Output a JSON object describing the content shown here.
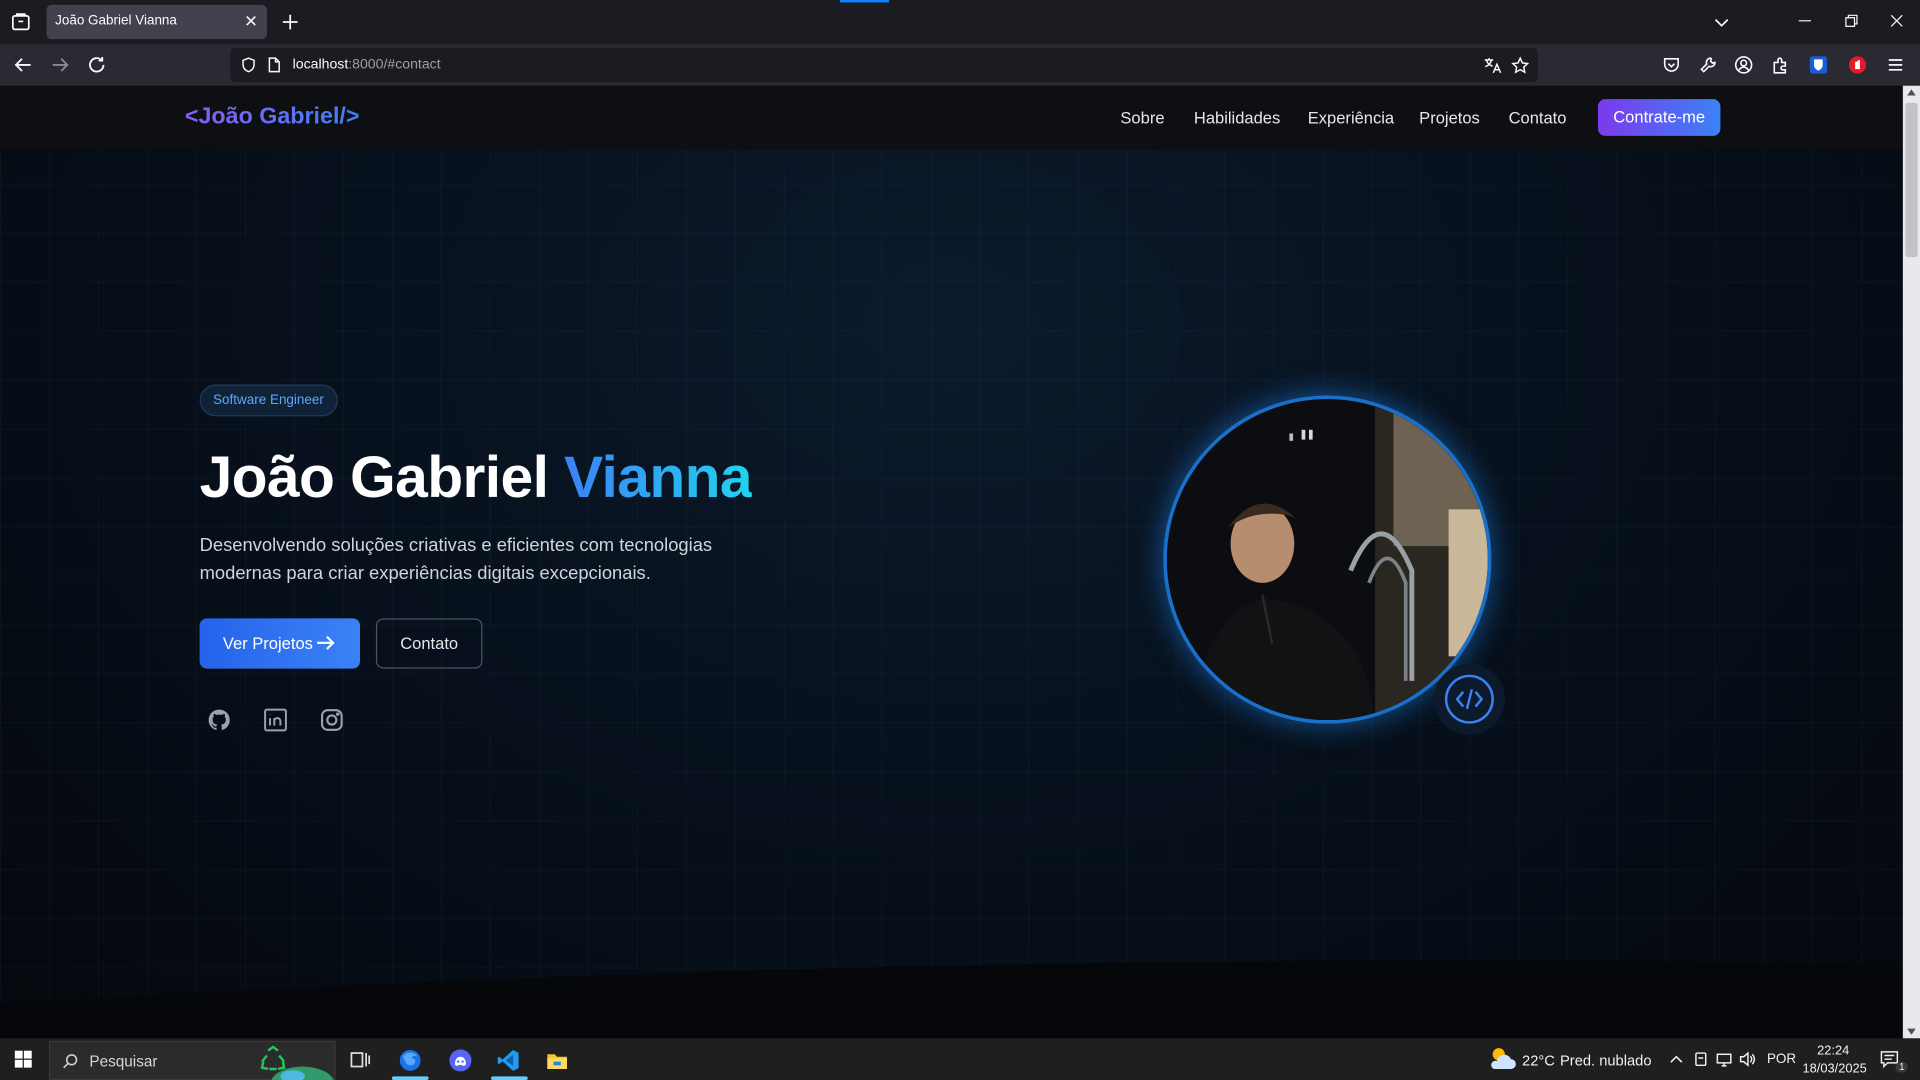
{
  "browser": {
    "tab_title": "João Gabriel Vianna",
    "url_host": "localhost",
    "url_rest": ":8000/#contact",
    "icons": [
      "tab-list-icon",
      "close-icon",
      "plus-icon",
      "chevron-down-icon",
      "minimize-icon",
      "restore-icon",
      "close-window-icon",
      "back-icon",
      "forward-icon",
      "reload-icon",
      "shield-icon",
      "page-icon",
      "translate-icon",
      "star-icon",
      "pocket-icon",
      "wrench-icon",
      "account-icon",
      "extensions-icon",
      "bitwarden-icon",
      "adblock-icon",
      "menu-icon"
    ]
  },
  "site": {
    "logo": "<João Gabriel/>",
    "nav": [
      "Sobre",
      "Habilidades",
      "Experiência",
      "Projetos",
      "Contato"
    ],
    "cta": "Contrate-me",
    "badge": "Software Engineer",
    "title_first": "João Gabriel ",
    "title_accent": "Vianna",
    "description": "Desenvolvendo soluções criativas e eficientes com tecnologias modernas para criar experiências digitais excepcionais.",
    "primary_button": "Ver Projetos",
    "secondary_button": "Contato",
    "social": [
      "github-icon",
      "linkedin-icon",
      "instagram-icon"
    ],
    "avatar_badge_icon": "code-icon",
    "colors": {
      "accent_blue": "#3b82f6",
      "accent_purple": "#7c3aed",
      "accent_cyan": "#22d3ee"
    }
  },
  "taskbar": {
    "search_placeholder": "Pesquisar",
    "weather_temp": "22°C",
    "weather_text": "Pred. nublado",
    "language": "POR",
    "time": "22:24",
    "date": "18/03/2025",
    "notification_count": "1",
    "apps": [
      "windows-start-icon",
      "recycle-bin-icon",
      "task-view-icon",
      "firefox-icon",
      "discord-icon",
      "vscode-icon",
      "file-explorer-icon"
    ]
  }
}
